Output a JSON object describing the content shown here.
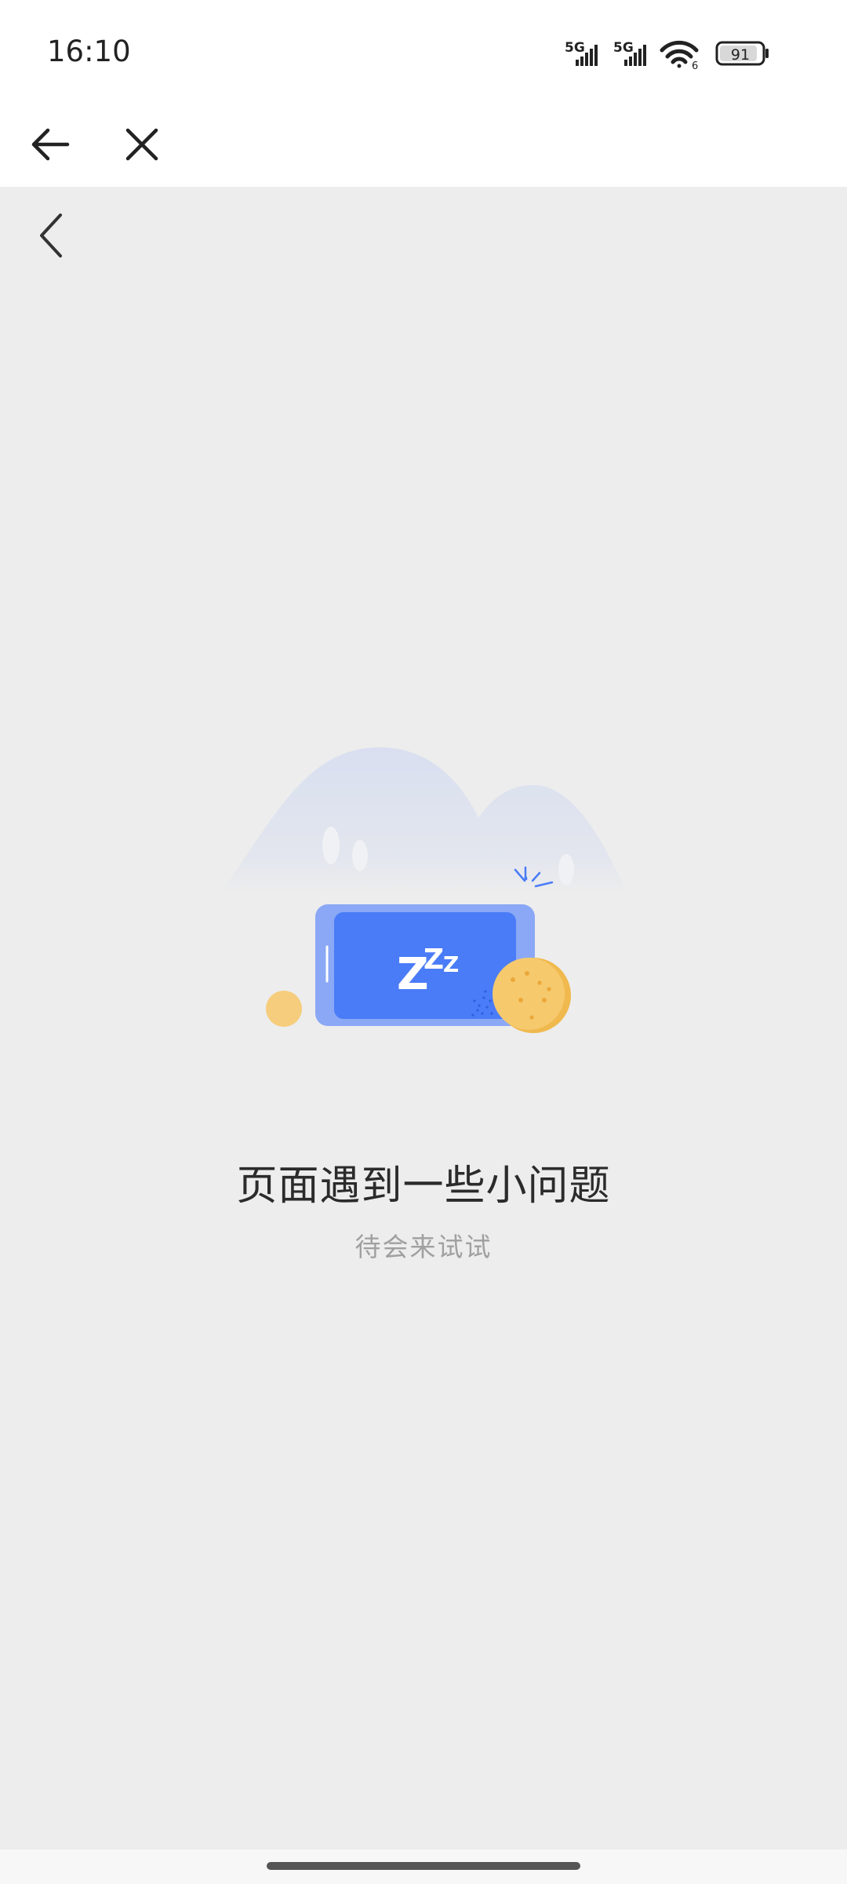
{
  "status_bar": {
    "time": "16:10",
    "signal1_label": "5G",
    "signal2_label": "5G",
    "wifi_label": "6",
    "battery": "91"
  },
  "nav": {
    "back_icon": "arrow-left-icon",
    "close_icon": "close-icon"
  },
  "page": {
    "back_icon": "chevron-left-icon",
    "illustration": {
      "screen_text": "Z",
      "accent_color": "#4a7cf7",
      "frame_color": "#8aa8f5",
      "coin_color": "#f5c66a"
    },
    "error_title": "页面遇到一些小问题",
    "error_subtitle": "待会来试试"
  }
}
